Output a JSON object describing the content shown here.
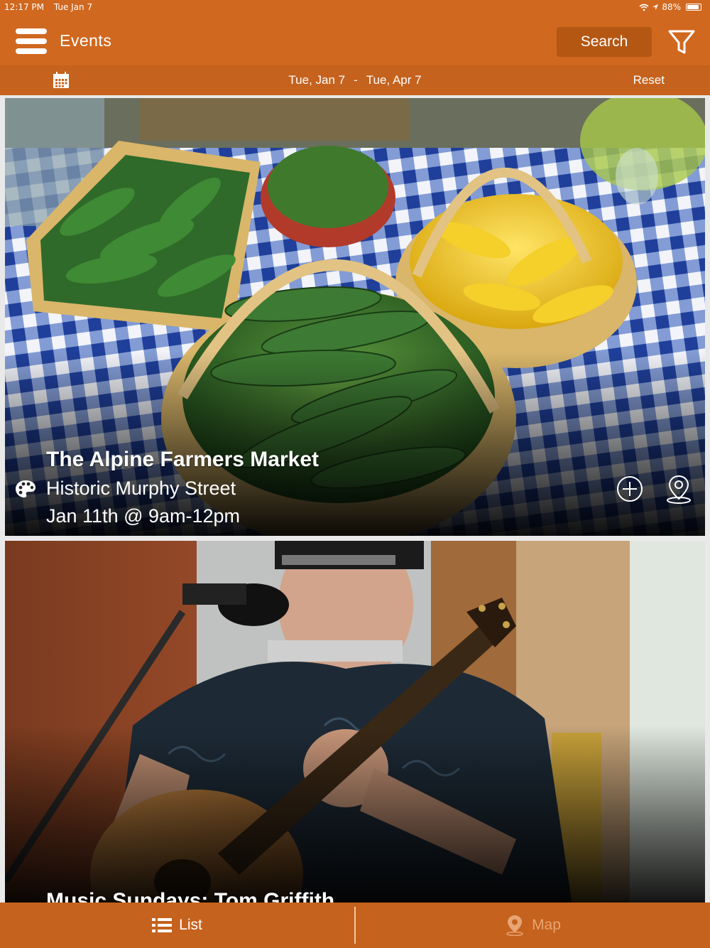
{
  "status_bar": {
    "time": "12:17 PM",
    "date": "Tue Jan 7",
    "battery": "88%",
    "battery_level": 0.88
  },
  "header": {
    "title": "Events",
    "search_label": "Search"
  },
  "date_bar": {
    "start": "Tue, Jan 7",
    "separator": "-",
    "end": "Tue, Apr 7",
    "reset_label": "Reset"
  },
  "events": [
    {
      "title": "The Alpine Farmers Market",
      "location": "Historic Murphy Street",
      "time": "Jan 11th @ 9am-12pm",
      "category_icon": "palette-icon"
    },
    {
      "title": "Music Sundays: Tom Griffith"
    }
  ],
  "tabs": {
    "list_label": "List",
    "map_label": "Map"
  },
  "colors": {
    "primary": "#d0681f",
    "secondary_bar": "#c5621d",
    "search_button": "#b45713",
    "inactive_tab": "#e9a474"
  }
}
